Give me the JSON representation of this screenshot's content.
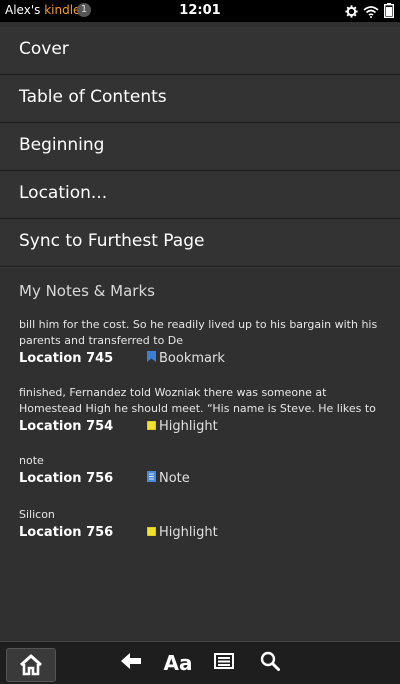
{
  "status_bar": {
    "owner_name": "Alex's",
    "brand": "kindle",
    "notification_count": "1",
    "time": "12:01"
  },
  "menu": {
    "items": [
      {
        "label": "Cover"
      },
      {
        "label": "Table of Contents"
      },
      {
        "label": "Beginning"
      },
      {
        "label": "Location..."
      },
      {
        "label": "Sync to Furthest Page"
      }
    ]
  },
  "notes": {
    "header": "My Notes & Marks",
    "entries": [
      {
        "excerpt": "bill him for the cost. So he readily lived up to his bargain with his parents and transferred to De",
        "location": "Location 745",
        "type": "Bookmark",
        "icon": "bookmark-icon",
        "color": "#3b7fd6"
      },
      {
        "excerpt": "finished, Fernandez told Wozniak there was someone at Homestead High he should meet. “His name is Steve. He likes to",
        "location": "Location 754",
        "type": "Highlight",
        "icon": "highlight-icon",
        "color": "#f2e32a"
      },
      {
        "excerpt": "note",
        "location": "Location 756",
        "type": "Note",
        "icon": "note-icon",
        "color": "#4a8ad8"
      },
      {
        "excerpt": "Silicon",
        "location": "Location 756",
        "type": "Highlight",
        "icon": "highlight-icon",
        "color": "#f2e32a"
      }
    ]
  },
  "bottom_bar": {
    "font_label": "Aa",
    "icons": [
      "home-icon",
      "back-icon",
      "font-icon",
      "notes-list-icon",
      "search-icon"
    ]
  }
}
